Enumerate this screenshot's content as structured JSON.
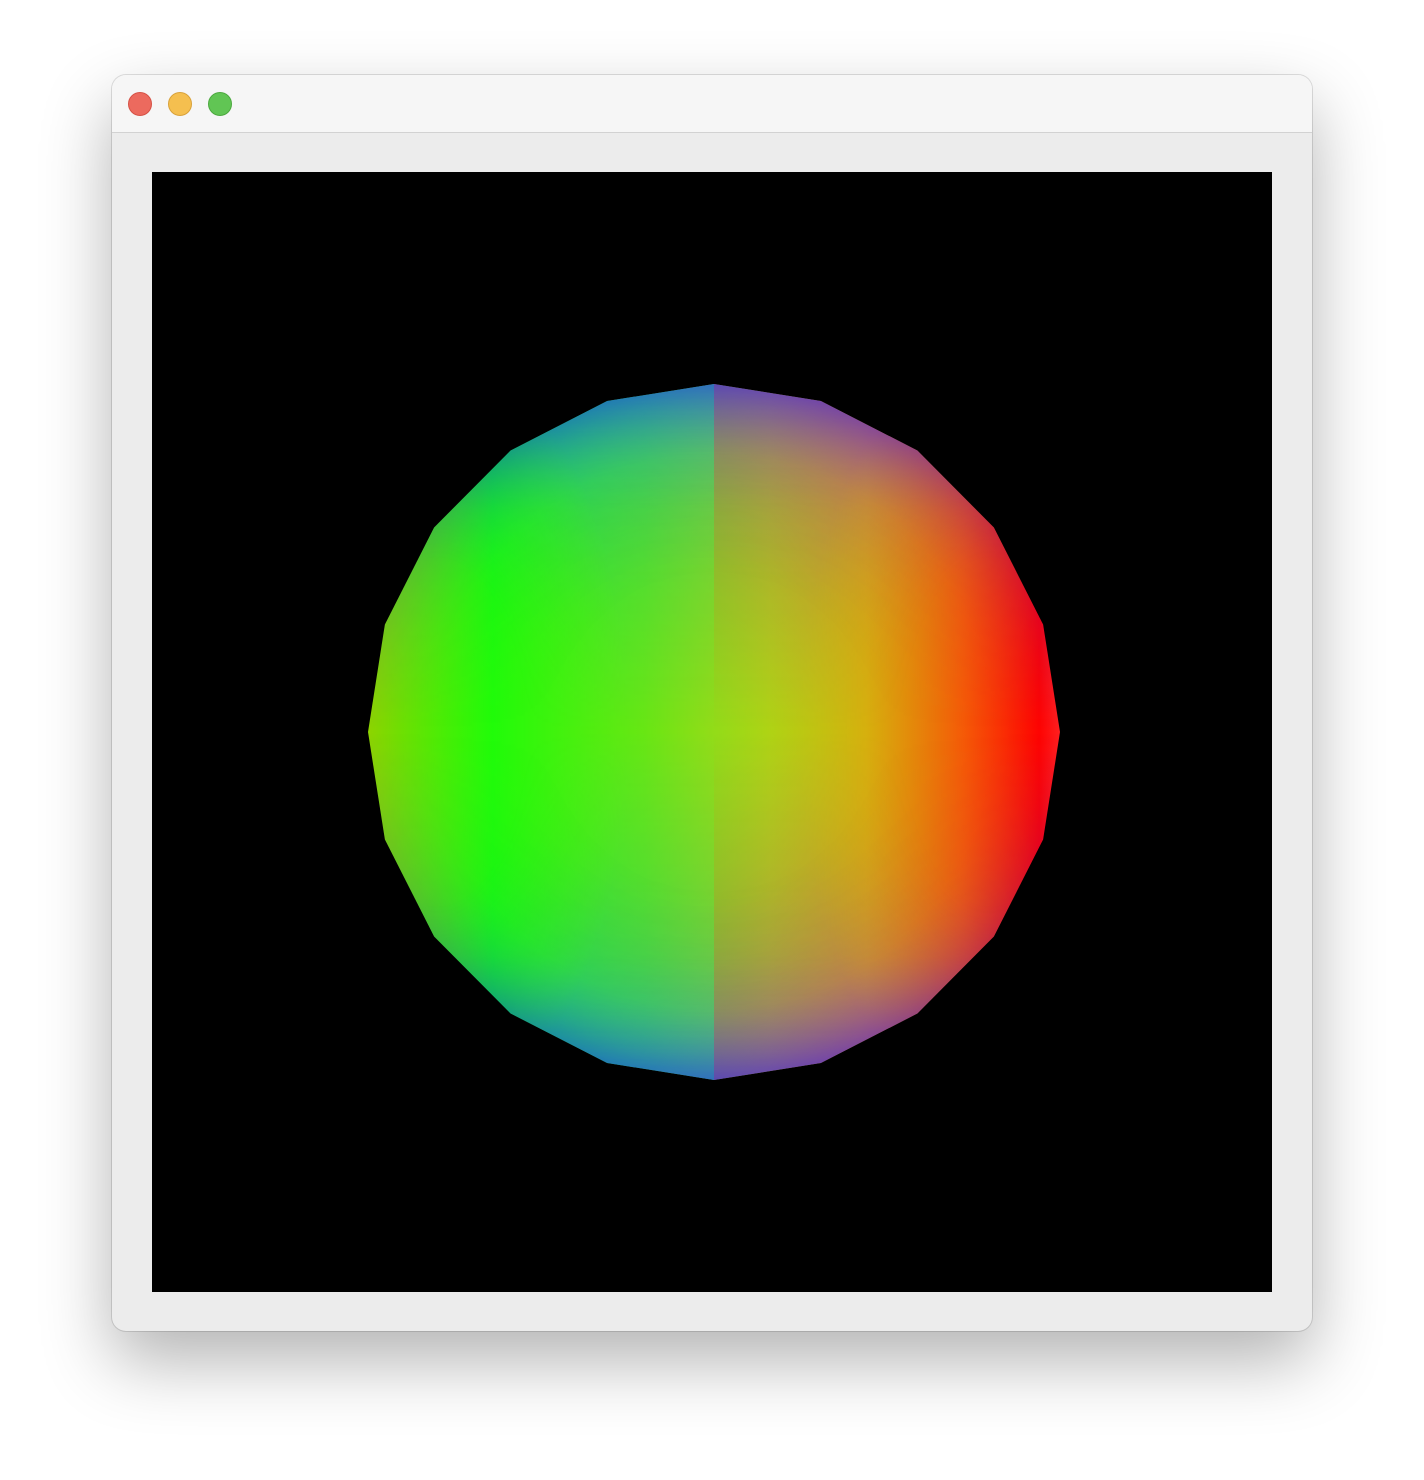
{
  "window": {
    "controls": [
      {
        "name": "close",
        "color": "#ec6a5e"
      },
      {
        "name": "minimize",
        "color": "#f5bf4f"
      },
      {
        "name": "maximize",
        "color": "#61c554"
      }
    ]
  },
  "canvas": {
    "background": "#000000",
    "object": "sphere",
    "shading": "normal-map-rainbow",
    "colors": {
      "left": "#00ff00",
      "right": "#ff0000",
      "top": "#0000ff",
      "bottom": "#0000ff",
      "top_right": "#9000d0",
      "bottom_right": "#9000d0",
      "center": "#9ee000"
    }
  }
}
